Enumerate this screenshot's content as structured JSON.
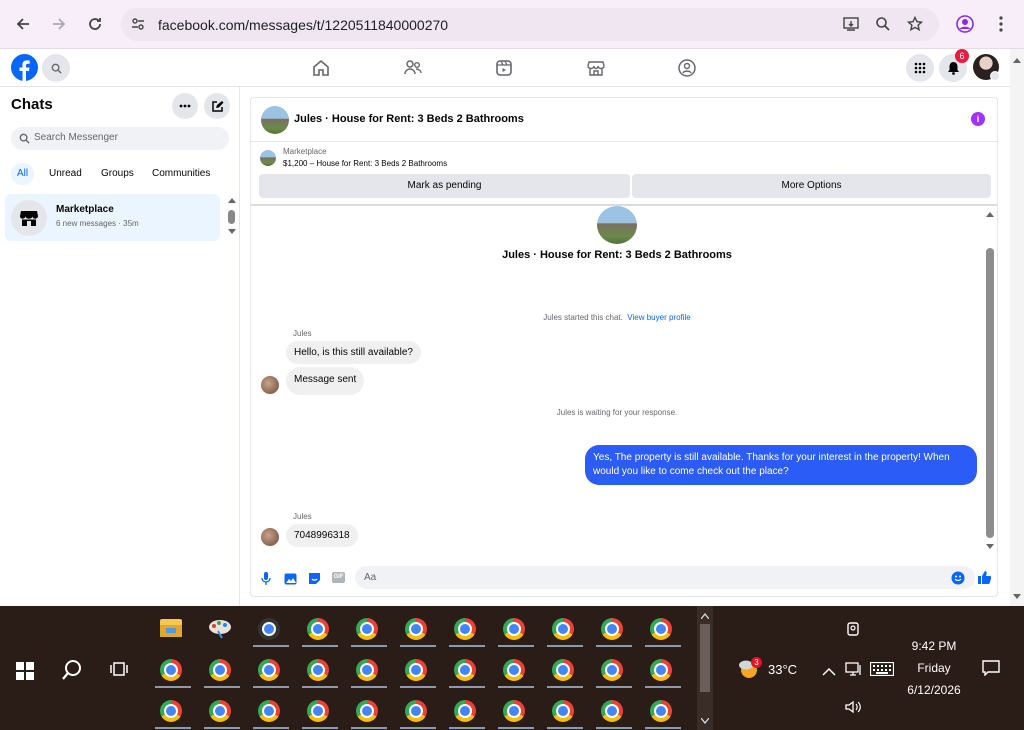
{
  "browser": {
    "url": "facebook.com/messages/t/1220511840000270"
  },
  "fbheader": {
    "notification_count": "6"
  },
  "sidebar": {
    "title": "Chats",
    "search_placeholder": "Search Messenger",
    "filters": [
      "All",
      "Unread",
      "Groups",
      "Communities"
    ],
    "chat": {
      "name": "Marketplace",
      "preview": "6 new messages · 35m"
    }
  },
  "conversation": {
    "header_title": "Jules · House for Rent: 3 Beds 2 Bathrooms",
    "listing_label": "Marketplace",
    "listing_detail": "$1,200 – House for Rent: 3 Beds 2 Bathrooms",
    "mark_pending": "Mark as pending",
    "more_options": "More Options",
    "intro_title": "Jules · House for Rent: 3 Beds 2 Bathrooms",
    "started_text": "Jules started this chat.",
    "view_profile": "View buyer profile",
    "sender1": "Jules",
    "msg1": "Hello, is this still available?",
    "msg2": "Message sent",
    "waiting_text": "Jules is waiting for your response.",
    "my_msg": "Yes, The property is still available. Thanks for your interest in the property! When would you like to come check out the place?",
    "sender2": "Jules",
    "msg3": "7048996318",
    "input_placeholder": "Aa",
    "gif_label": "GIF"
  },
  "taskbar": {
    "weather_badge": "3",
    "temperature": "33°C",
    "time": "9:42 PM",
    "day": "Friday",
    "date": "6/12/2026"
  },
  "colors": {
    "fb_blue": "#0866ff",
    "my_bubble": "#2b5cf6",
    "purple_info": "#a033ff",
    "notif_red": "#e41e3f"
  }
}
